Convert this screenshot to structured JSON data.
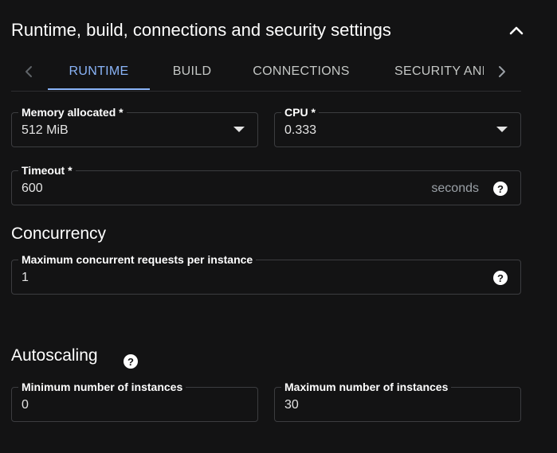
{
  "section": {
    "title": "Runtime, build, connections and security settings"
  },
  "tabs": [
    {
      "label": "RUNTIME",
      "active": true
    },
    {
      "label": "BUILD",
      "active": false
    },
    {
      "label": "CONNECTIONS",
      "active": false
    },
    {
      "label": "SECURITY AND",
      "active": false
    }
  ],
  "runtime": {
    "memory": {
      "label": "Memory allocated *",
      "value": "512 MiB"
    },
    "cpu": {
      "label": "CPU *",
      "value": "0.333"
    },
    "timeout": {
      "label": "Timeout *",
      "value": "600",
      "suffix": "seconds"
    }
  },
  "concurrency": {
    "heading": "Concurrency",
    "max_requests": {
      "label": "Maximum concurrent requests per instance",
      "value": "1"
    }
  },
  "autoscaling": {
    "heading": "Autoscaling",
    "min_instances": {
      "label": "Minimum number of instances",
      "value": "0"
    },
    "max_instances": {
      "label": "Maximum number of instances",
      "value": "30"
    }
  },
  "colors": {
    "background": "#131314",
    "accent": "#8ab4f8",
    "border": "#3c3d40"
  },
  "icons": {
    "collapse": "chevron-up-icon",
    "scroll_left": "chevron-left-icon",
    "scroll_right": "chevron-right-icon",
    "dropdown": "arrow-drop-down-icon",
    "help": "help-icon"
  }
}
